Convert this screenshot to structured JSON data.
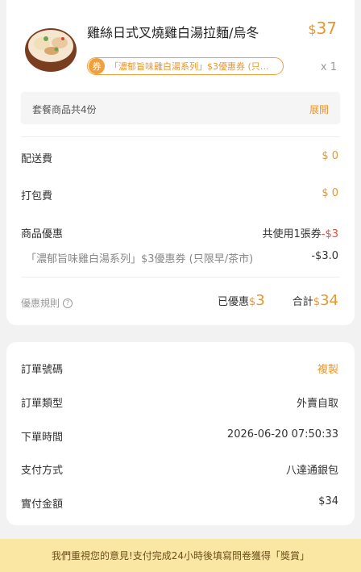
{
  "item": {
    "title": "雞絲日式叉燒雞白湯拉麵/烏冬",
    "currency": "$",
    "price": "37",
    "coupon_badge": "券",
    "coupon_text": "「濃郁旨味雞白湯系列」$3優惠券 (只…",
    "quantity": "x 1"
  },
  "set_bar": {
    "text": "套餐商品共4份",
    "expand": "展開"
  },
  "fees": [
    {
      "label": "配送費",
      "value": "$ 0"
    },
    {
      "label": "打包費",
      "value": "$ 0"
    }
  ],
  "discount": {
    "label": "商品優惠",
    "used_text": "共使用1張券",
    "used_amount": "-$3",
    "coupon_name": "「濃郁旨味雞白湯系列」$3優惠券 (只限早/茶市)",
    "coupon_amount": "-$3.0"
  },
  "summary": {
    "rules_label": "優惠規則",
    "help_icon": "?",
    "discount_label": "已優惠",
    "discount_currency": "$",
    "discount_amount": "3",
    "total_label": "合計",
    "total_currency": "$",
    "total_amount": "34"
  },
  "order": {
    "number_label": "訂單號碼",
    "copy": "複製",
    "type_label": "訂單類型",
    "type_value": "外賣自取",
    "time_label": "下單時間",
    "time_value": "2026-06-20 07:50:33",
    "payment_label": "支付方式",
    "payment_value": "八達通銀包",
    "paid_label": "實付金額",
    "paid_value": "$34"
  },
  "banner": {
    "text": "我們重視您的意見!支付完成24小時後填寫問卷獲得「獎賞」"
  },
  "colors": {
    "accent": "#e8962e",
    "discount_red": "#e84a3b",
    "banner_bg": "#fbe7a4"
  }
}
